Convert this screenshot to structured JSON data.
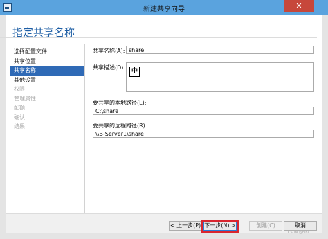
{
  "window": {
    "title": "新建共享向导"
  },
  "wizard": {
    "heading": "指定共享名称"
  },
  "steps": [
    {
      "label": "选择配置文件",
      "state": "normal"
    },
    {
      "label": "共享位置",
      "state": "normal"
    },
    {
      "label": "共享名称",
      "state": "active"
    },
    {
      "label": "其他设置",
      "state": "normal"
    },
    {
      "label": "权限",
      "state": "disabled"
    },
    {
      "label": "管理属性",
      "state": "disabled"
    },
    {
      "label": "配额",
      "state": "disabled"
    },
    {
      "label": "确认",
      "state": "disabled"
    },
    {
      "label": "结果",
      "state": "disabled"
    }
  ],
  "form": {
    "share_name_label": "共享名称(A):",
    "share_name_value": "share",
    "description_label": "共享描述(D):",
    "ime_indicator": "中",
    "local_path_label": "要共享的本地路径(L):",
    "local_path_value": "C:\\share",
    "remote_path_label": "要共享的远程路径(R):",
    "remote_path_value": "\\\\B-Server1\\share"
  },
  "buttons": {
    "previous": "< 上一步(P)",
    "next": "下一步(N) >",
    "create": "创建(C)",
    "cancel": "取消"
  },
  "icons": {
    "app": "wizard-app-icon",
    "close": "close-icon"
  },
  "colors": {
    "titlebar": "#5aa3de",
    "accent": "#2f6ab6",
    "heading": "#1f5fa5",
    "close": "#c7473b",
    "highlight": "#d9262f"
  },
  "watermark": "CSDN @nihil"
}
